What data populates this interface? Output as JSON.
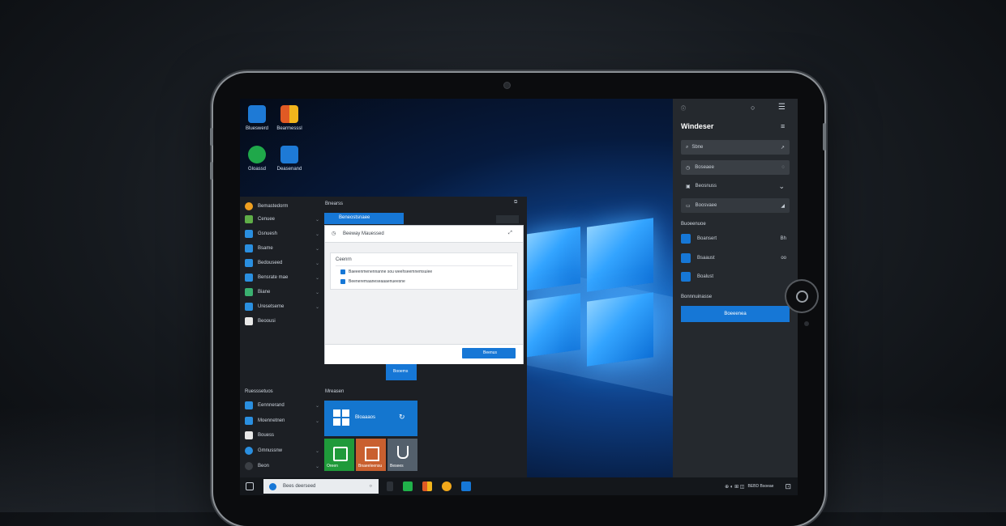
{
  "desktop": {
    "icons": [
      {
        "label": "Blueswerd",
        "color": "#1e7ad6",
        "icon": "windows-blue-icon"
      },
      {
        "label": "Bearmesssl",
        "color": "#e0a21a",
        "icon": "windows-color-icon"
      },
      {
        "label": "Gloassd",
        "color": "#1fa84a",
        "icon": "refresh-green-icon"
      },
      {
        "label": "Deasenand",
        "color": "#1e7ad6",
        "icon": "globe-blue-icon"
      }
    ]
  },
  "start_menu": {
    "header_label": "Bemastedorm",
    "list": [
      {
        "label": "Cenuee",
        "color": "#5fae48"
      },
      {
        "label": "Gsnuesh",
        "color": "#2a8fe0"
      },
      {
        "label": "Bsame",
        "color": "#2a8fe0"
      },
      {
        "label": "Bedouseed",
        "color": "#2a8fe0"
      },
      {
        "label": "Bensrate mae",
        "color": "#2a8fe0"
      },
      {
        "label": "Biane",
        "color": "#3ab070"
      },
      {
        "label": "Uresetseme",
        "color": "#2a8fe0"
      },
      {
        "label": "Beoousi",
        "color": "#e8e8e8"
      }
    ],
    "section2_label": "Ruesssetuos",
    "list2": [
      {
        "label": "Eennnerand",
        "color": "#2a8fe0"
      },
      {
        "label": "Moennetnen",
        "color": "#2a8fe0"
      },
      {
        "label": "Bouess",
        "color": "#e8e8e8"
      },
      {
        "label": "Gmnussnw",
        "color": "#2a8fe0"
      },
      {
        "label": "Beon",
        "color": "#3b3f45"
      }
    ],
    "pane_title": "Bnearss",
    "pane_tab": "Beneostsnaee",
    "tile_group": "Mreasen",
    "tiles": [
      {
        "label": "Bloaaaos",
        "color": "#1476cf"
      },
      {
        "label": "Oreen",
        "color": "#1f9a3a"
      },
      {
        "label": "Bnaeeleensu",
        "color": "#c9602f"
      },
      {
        "label": "Besees",
        "color": "#54606c"
      }
    ],
    "blue_button": "Booems"
  },
  "dialog": {
    "title": "Beeway Mauessed",
    "section": "Ceenrn",
    "items": [
      "Baeeenmenennanne sou weehseemnemsuiee",
      "Beeneremaaneseaaaenueesne"
    ],
    "ok": "Beenus"
  },
  "right_panel": {
    "title": "Windeser",
    "search": "Sbne",
    "row1": "Boseaee",
    "row2": "Beosnuss",
    "row3": "Boosvaee",
    "section": "Buoeenuoe",
    "items": [
      {
        "label": "Boansert",
        "badge": "Bh"
      },
      {
        "label": "Bsaaust",
        "badge": "oo"
      },
      {
        "label": "Boalust",
        "badge": ""
      }
    ],
    "section2": "Bonnnuinasse",
    "button": "Boeeenea"
  },
  "taskbar": {
    "search_placeholder": "Bees deerseed",
    "time": "BEBD Bsoeae"
  }
}
